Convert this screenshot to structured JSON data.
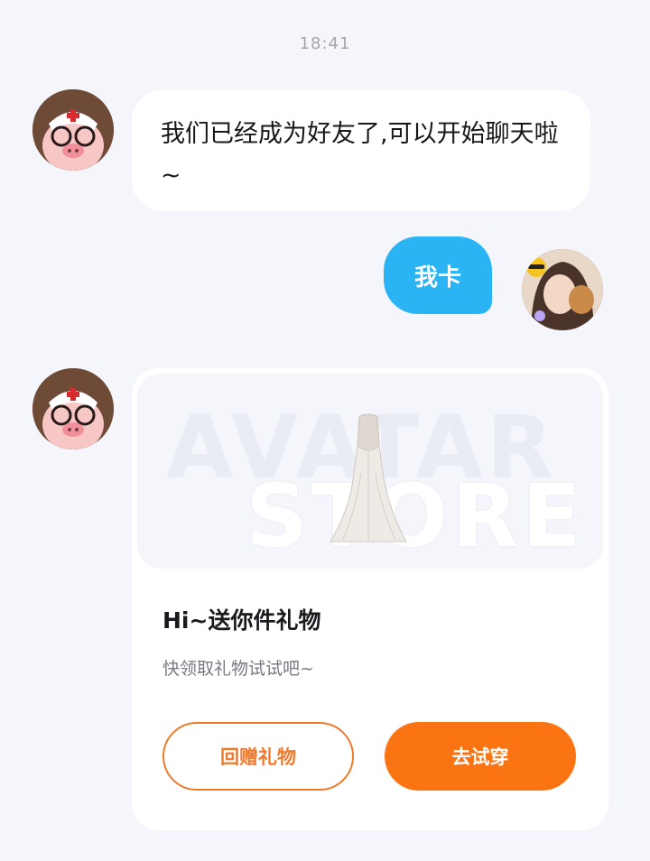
{
  "chat": {
    "timestamp": "18:41",
    "messages": [
      {
        "sender": "friend",
        "text": "我们已经成为好友了,可以开始聊天啦~"
      },
      {
        "sender": "me",
        "text": "我卡"
      }
    ],
    "gift_card": {
      "banner_words": [
        "AVATAR",
        "STORE"
      ],
      "title": "Hi~送你件礼物",
      "subtitle": "快领取礼物试试吧~",
      "return_gift_label": "回赠礼物",
      "try_on_label": "去试穿"
    }
  },
  "colors": {
    "background": "#f5f6fb",
    "outgoing_bubble": "#2bb4f4",
    "accent_orange": "#fb7414"
  }
}
